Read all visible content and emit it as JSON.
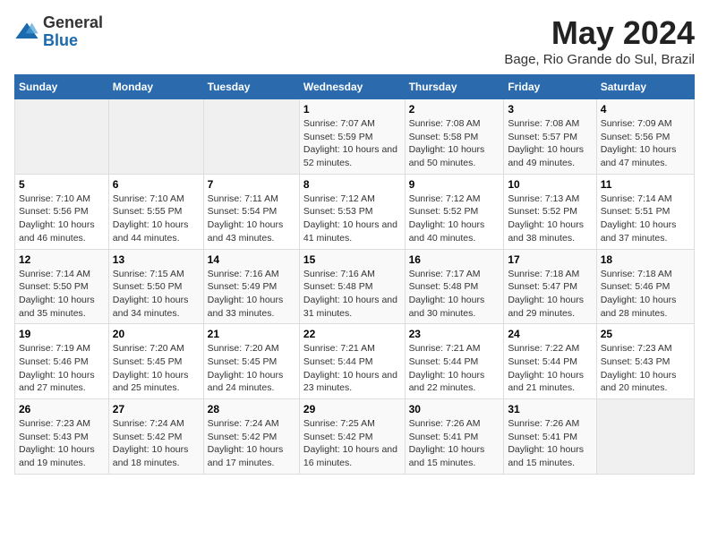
{
  "logo": {
    "general": "General",
    "blue": "Blue"
  },
  "title": "May 2024",
  "subtitle": "Bage, Rio Grande do Sul, Brazil",
  "days_of_week": [
    "Sunday",
    "Monday",
    "Tuesday",
    "Wednesday",
    "Thursday",
    "Friday",
    "Saturday"
  ],
  "weeks": [
    [
      {
        "day": "",
        "info": ""
      },
      {
        "day": "",
        "info": ""
      },
      {
        "day": "",
        "info": ""
      },
      {
        "day": "1",
        "info": "Sunrise: 7:07 AM\nSunset: 5:59 PM\nDaylight: 10 hours and 52 minutes."
      },
      {
        "day": "2",
        "info": "Sunrise: 7:08 AM\nSunset: 5:58 PM\nDaylight: 10 hours and 50 minutes."
      },
      {
        "day": "3",
        "info": "Sunrise: 7:08 AM\nSunset: 5:57 PM\nDaylight: 10 hours and 49 minutes."
      },
      {
        "day": "4",
        "info": "Sunrise: 7:09 AM\nSunset: 5:56 PM\nDaylight: 10 hours and 47 minutes."
      }
    ],
    [
      {
        "day": "5",
        "info": "Sunrise: 7:10 AM\nSunset: 5:56 PM\nDaylight: 10 hours and 46 minutes."
      },
      {
        "day": "6",
        "info": "Sunrise: 7:10 AM\nSunset: 5:55 PM\nDaylight: 10 hours and 44 minutes."
      },
      {
        "day": "7",
        "info": "Sunrise: 7:11 AM\nSunset: 5:54 PM\nDaylight: 10 hours and 43 minutes."
      },
      {
        "day": "8",
        "info": "Sunrise: 7:12 AM\nSunset: 5:53 PM\nDaylight: 10 hours and 41 minutes."
      },
      {
        "day": "9",
        "info": "Sunrise: 7:12 AM\nSunset: 5:52 PM\nDaylight: 10 hours and 40 minutes."
      },
      {
        "day": "10",
        "info": "Sunrise: 7:13 AM\nSunset: 5:52 PM\nDaylight: 10 hours and 38 minutes."
      },
      {
        "day": "11",
        "info": "Sunrise: 7:14 AM\nSunset: 5:51 PM\nDaylight: 10 hours and 37 minutes."
      }
    ],
    [
      {
        "day": "12",
        "info": "Sunrise: 7:14 AM\nSunset: 5:50 PM\nDaylight: 10 hours and 35 minutes."
      },
      {
        "day": "13",
        "info": "Sunrise: 7:15 AM\nSunset: 5:50 PM\nDaylight: 10 hours and 34 minutes."
      },
      {
        "day": "14",
        "info": "Sunrise: 7:16 AM\nSunset: 5:49 PM\nDaylight: 10 hours and 33 minutes."
      },
      {
        "day": "15",
        "info": "Sunrise: 7:16 AM\nSunset: 5:48 PM\nDaylight: 10 hours and 31 minutes."
      },
      {
        "day": "16",
        "info": "Sunrise: 7:17 AM\nSunset: 5:48 PM\nDaylight: 10 hours and 30 minutes."
      },
      {
        "day": "17",
        "info": "Sunrise: 7:18 AM\nSunset: 5:47 PM\nDaylight: 10 hours and 29 minutes."
      },
      {
        "day": "18",
        "info": "Sunrise: 7:18 AM\nSunset: 5:46 PM\nDaylight: 10 hours and 28 minutes."
      }
    ],
    [
      {
        "day": "19",
        "info": "Sunrise: 7:19 AM\nSunset: 5:46 PM\nDaylight: 10 hours and 27 minutes."
      },
      {
        "day": "20",
        "info": "Sunrise: 7:20 AM\nSunset: 5:45 PM\nDaylight: 10 hours and 25 minutes."
      },
      {
        "day": "21",
        "info": "Sunrise: 7:20 AM\nSunset: 5:45 PM\nDaylight: 10 hours and 24 minutes."
      },
      {
        "day": "22",
        "info": "Sunrise: 7:21 AM\nSunset: 5:44 PM\nDaylight: 10 hours and 23 minutes."
      },
      {
        "day": "23",
        "info": "Sunrise: 7:21 AM\nSunset: 5:44 PM\nDaylight: 10 hours and 22 minutes."
      },
      {
        "day": "24",
        "info": "Sunrise: 7:22 AM\nSunset: 5:44 PM\nDaylight: 10 hours and 21 minutes."
      },
      {
        "day": "25",
        "info": "Sunrise: 7:23 AM\nSunset: 5:43 PM\nDaylight: 10 hours and 20 minutes."
      }
    ],
    [
      {
        "day": "26",
        "info": "Sunrise: 7:23 AM\nSunset: 5:43 PM\nDaylight: 10 hours and 19 minutes."
      },
      {
        "day": "27",
        "info": "Sunrise: 7:24 AM\nSunset: 5:42 PM\nDaylight: 10 hours and 18 minutes."
      },
      {
        "day": "28",
        "info": "Sunrise: 7:24 AM\nSunset: 5:42 PM\nDaylight: 10 hours and 17 minutes."
      },
      {
        "day": "29",
        "info": "Sunrise: 7:25 AM\nSunset: 5:42 PM\nDaylight: 10 hours and 16 minutes."
      },
      {
        "day": "30",
        "info": "Sunrise: 7:26 AM\nSunset: 5:41 PM\nDaylight: 10 hours and 15 minutes."
      },
      {
        "day": "31",
        "info": "Sunrise: 7:26 AM\nSunset: 5:41 PM\nDaylight: 10 hours and 15 minutes."
      },
      {
        "day": "",
        "info": ""
      }
    ]
  ]
}
